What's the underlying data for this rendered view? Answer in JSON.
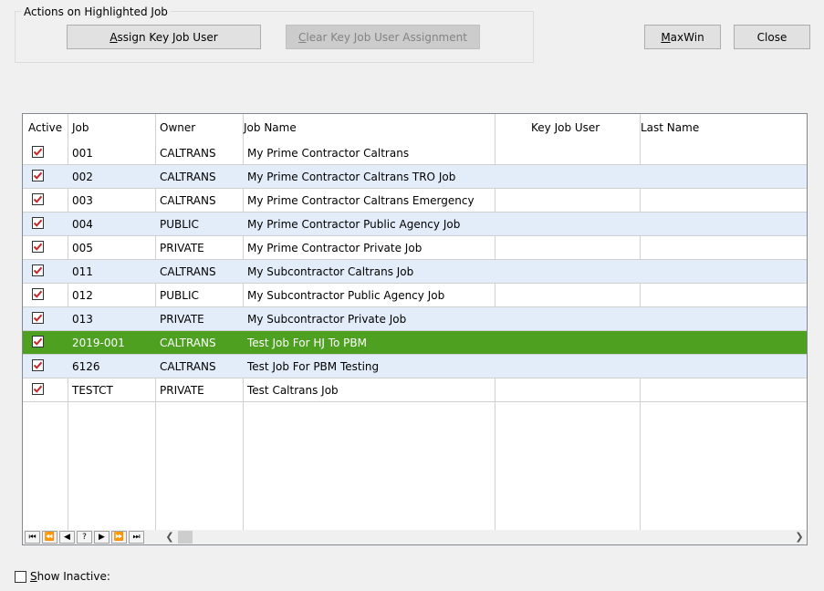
{
  "actions_group": {
    "title": "Actions on Highlighted Job",
    "assign": {
      "prefix": "",
      "hotkey": "A",
      "rest": "ssign Key Job User"
    },
    "clear": {
      "prefix": "",
      "hotkey": "C",
      "rest": "lear Key Job User Assignment"
    }
  },
  "maxwin": {
    "hotkey": "M",
    "rest": "axWin"
  },
  "close_label": "Close",
  "grid": {
    "columns": [
      "Active",
      "Job",
      "Owner",
      "Job Name",
      "Key Job User",
      "Last Name"
    ],
    "rows": [
      {
        "active": true,
        "job": "001",
        "owner": "CALTRANS",
        "job_name": "My Prime Contractor Caltrans",
        "key_user": "",
        "last_name": ""
      },
      {
        "active": true,
        "job": "002",
        "owner": "CALTRANS",
        "job_name": "My Prime Contractor Caltrans TRO Job",
        "key_user": "",
        "last_name": ""
      },
      {
        "active": true,
        "job": "003",
        "owner": "CALTRANS",
        "job_name": "My Prime Contractor Caltrans Emergency",
        "key_user": "",
        "last_name": ""
      },
      {
        "active": true,
        "job": "004",
        "owner": "PUBLIC",
        "job_name": "My Prime Contractor Public Agency Job",
        "key_user": "",
        "last_name": ""
      },
      {
        "active": true,
        "job": "005",
        "owner": "PRIVATE",
        "job_name": "My Prime Contractor Private Job",
        "key_user": "",
        "last_name": ""
      },
      {
        "active": true,
        "job": "011",
        "owner": "CALTRANS",
        "job_name": "My Subcontractor Caltrans Job",
        "key_user": "",
        "last_name": ""
      },
      {
        "active": true,
        "job": "012",
        "owner": "PUBLIC",
        "job_name": "My Subcontractor Public Agency Job",
        "key_user": "",
        "last_name": ""
      },
      {
        "active": true,
        "job": "013",
        "owner": "PRIVATE",
        "job_name": "My Subcontractor Private Job",
        "key_user": "",
        "last_name": ""
      },
      {
        "active": true,
        "job": "2019-001",
        "owner": "CALTRANS",
        "job_name": "Test Job For HJ To PBM",
        "key_user": "",
        "last_name": "",
        "selected": true
      },
      {
        "active": true,
        "job": "6126",
        "owner": "CALTRANS",
        "job_name": "Test Job For PBM Testing",
        "key_user": "",
        "last_name": ""
      },
      {
        "active": true,
        "job": "TESTCT",
        "owner": "PRIVATE",
        "job_name": "Test Caltrans Job",
        "key_user": "",
        "last_name": ""
      }
    ]
  },
  "navigator": {
    "buttons": [
      "first-record",
      "prev-page",
      "prev-record",
      "help",
      "next-record",
      "next-page",
      "last-record"
    ],
    "glyphs": [
      "⏮",
      "⏪",
      "◀",
      "?",
      "▶",
      "⏩",
      "⏭"
    ]
  },
  "show_inactive": {
    "hotkey": "S",
    "rest": "how Inactive:",
    "checked": false
  },
  "colors": {
    "selected_row": "#4ea120",
    "alt_row": "#e3edf9"
  }
}
